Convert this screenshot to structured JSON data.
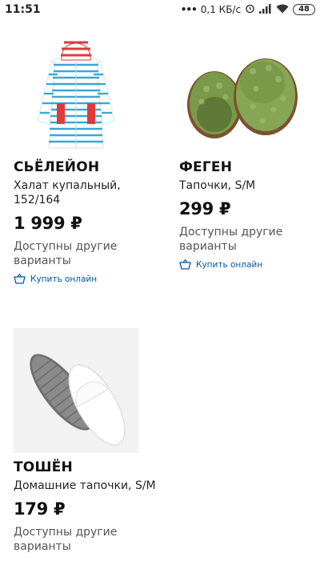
{
  "status_bar": {
    "time": "11:51",
    "network_speed": "0,1 КБ/с",
    "battery": "48"
  },
  "products": [
    {
      "name": "СЬЁЛЕЙОН",
      "description": "Халат купальный, 152/164",
      "price": "1 999 ₽",
      "variants": "Доступны другие варианты",
      "buy_online": "Купить онлайн"
    },
    {
      "name": "ФЕГЕН",
      "description": "Тапочки, S/M",
      "price": "299 ₽",
      "variants": "Доступны другие варианты",
      "buy_online": "Купить онлайн"
    },
    {
      "name": "ТОШЁН",
      "description": "Домашние тапочки, S/M",
      "price": "179 ₽",
      "variants": "Доступны другие варианты"
    }
  ],
  "icons": {
    "status": [
      "alarm-icon",
      "signal-icon",
      "wifi-icon",
      "battery-icon"
    ],
    "buy": "basket-icon"
  },
  "colors": {
    "link": "#0058a3",
    "bathrobe_stripe": "#3ba7d6",
    "bathrobe_hood": "#e03a3a",
    "green_slipper": "#7a9a4a"
  }
}
